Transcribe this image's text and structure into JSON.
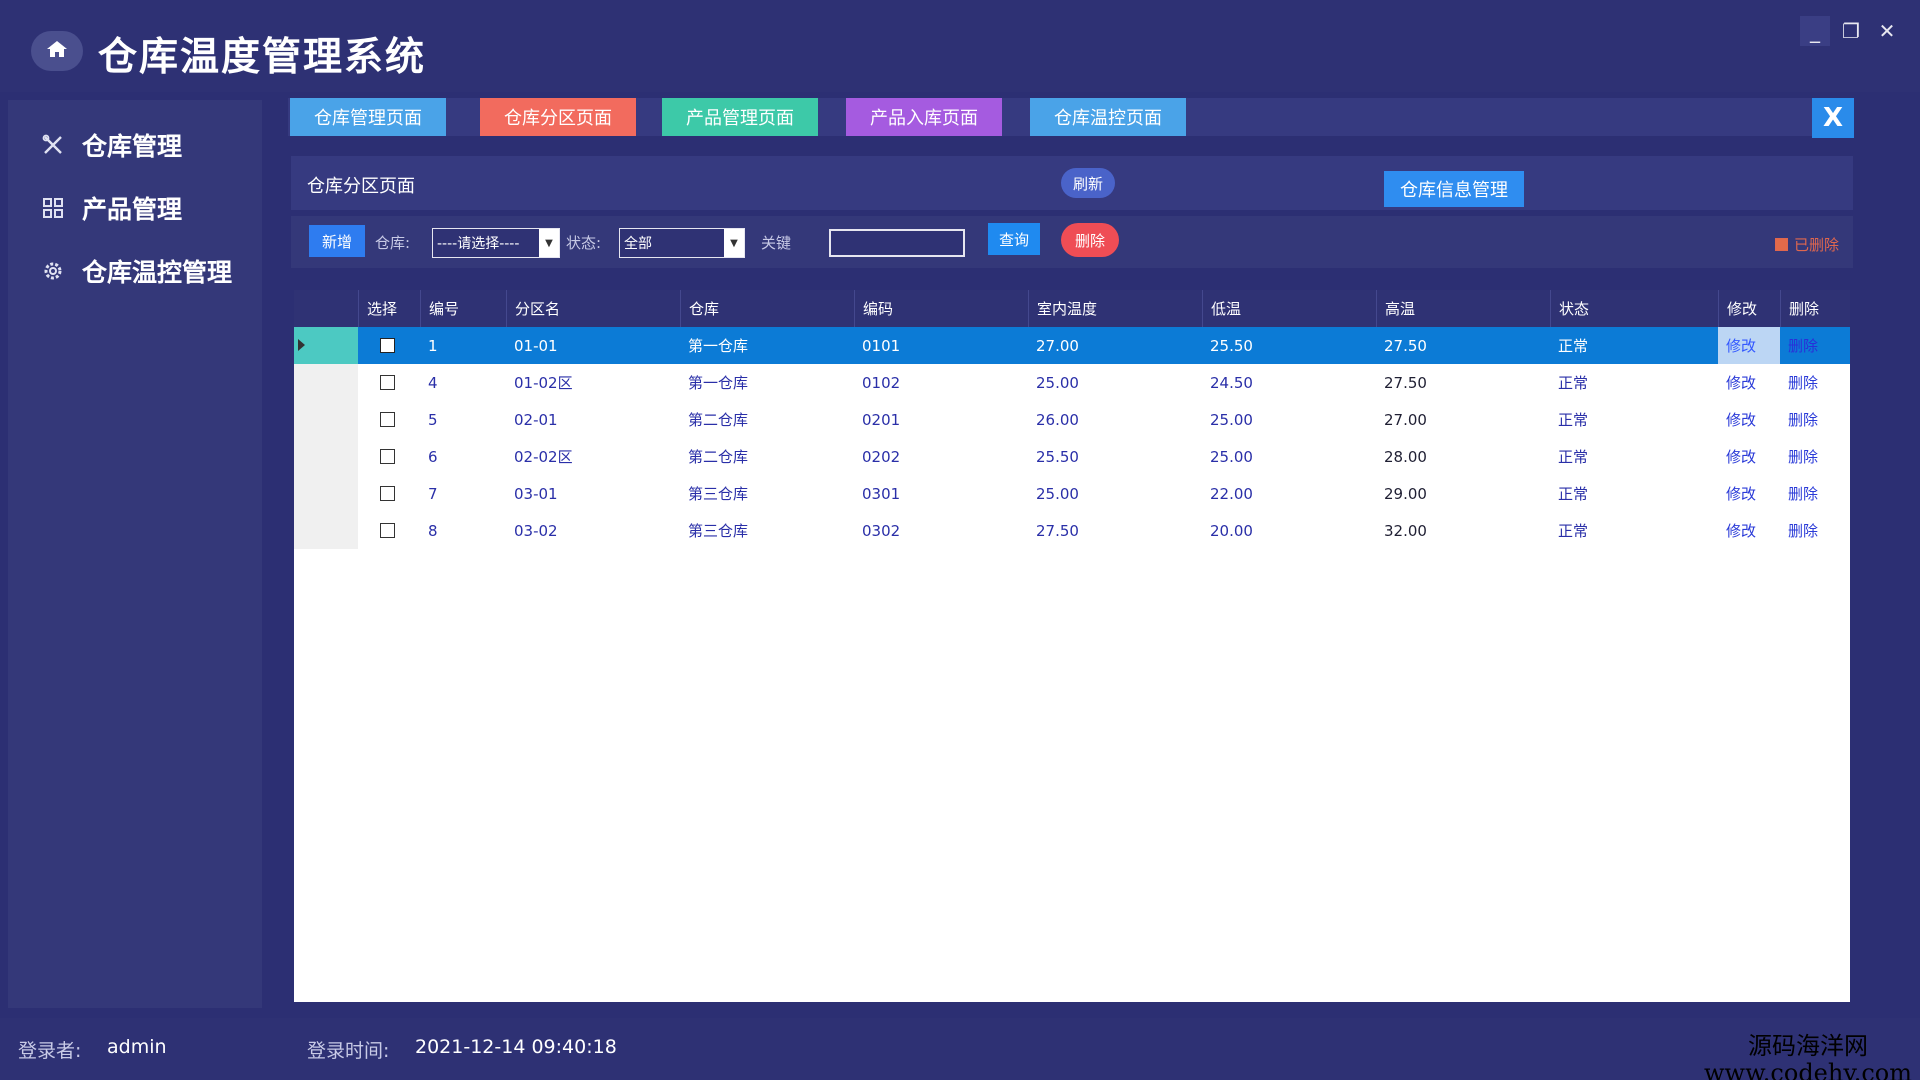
{
  "app": {
    "title": "仓库温度管理系统"
  },
  "window": {
    "minimize": "_",
    "restore": "❐",
    "close": "✕"
  },
  "sidebar": {
    "items": [
      {
        "label": "仓库管理",
        "icon": "tools-icon"
      },
      {
        "label": "产品管理",
        "icon": "grid-icon"
      },
      {
        "label": "仓库温控管理",
        "icon": "gear-icon"
      }
    ]
  },
  "tabs": [
    {
      "label": "仓库管理页面",
      "color": "#4aa3e8"
    },
    {
      "label": "仓库分区页面",
      "color": "#f26b5e"
    },
    {
      "label": "产品管理页面",
      "color": "#3dc9a8"
    },
    {
      "label": "产品入库页面",
      "color": "#a55be0"
    },
    {
      "label": "仓库温控页面",
      "color": "#4aa3e8"
    }
  ],
  "tab_close": "X",
  "page": {
    "title": "仓库分区页面",
    "refresh": "刷新",
    "info_button": "仓库信息管理"
  },
  "filters": {
    "add": "新增",
    "warehouse_label": "仓库:",
    "warehouse_value": "----请选择----",
    "status_label": "状态:",
    "status_value": "全部",
    "keyword_label": "关键",
    "keyword_value": "",
    "query": "查询",
    "delete": "删除",
    "deleted_label": "已删除"
  },
  "table": {
    "columns": [
      "选择",
      "编号",
      "分区名",
      "仓库",
      "编码",
      "室内温度",
      "低温",
      "高温",
      "状态",
      "修改",
      "删除"
    ],
    "rows": [
      {
        "id": "1",
        "zone": "01-01",
        "warehouse": "第一仓库",
        "code": "0101",
        "indoor": "27.00",
        "low": "25.50",
        "high": "27.50",
        "status": "正常",
        "edit": "修改",
        "del": "删除",
        "selected": true
      },
      {
        "id": "4",
        "zone": "01-02区",
        "warehouse": "第一仓库",
        "code": "0102",
        "indoor": "25.00",
        "low": "24.50",
        "high": "27.50",
        "status": "正常",
        "edit": "修改",
        "del": "删除"
      },
      {
        "id": "5",
        "zone": "02-01",
        "warehouse": "第二仓库",
        "code": "0201",
        "indoor": "26.00",
        "low": "25.00",
        "high": "27.00",
        "status": "正常",
        "edit": "修改",
        "del": "删除"
      },
      {
        "id": "6",
        "zone": "02-02区",
        "warehouse": "第二仓库",
        "code": "0202",
        "indoor": "25.50",
        "low": "25.00",
        "high": "28.00",
        "status": "正常",
        "edit": "修改",
        "del": "删除"
      },
      {
        "id": "7",
        "zone": "03-01",
        "warehouse": "第三仓库",
        "code": "0301",
        "indoor": "25.00",
        "low": "22.00",
        "high": "29.00",
        "status": "正常",
        "edit": "修改",
        "del": "删除"
      },
      {
        "id": "8",
        "zone": "03-02",
        "warehouse": "第三仓库",
        "code": "0302",
        "indoor": "27.50",
        "low": "20.00",
        "high": "32.00",
        "status": "正常",
        "edit": "修改",
        "del": "删除"
      }
    ]
  },
  "statusbar": {
    "user_label": "登录者:",
    "user": "admin",
    "time_label": "登录时间:",
    "time": "2021-12-14 09:40:18"
  },
  "watermark": {
    "line1": "源码海洋网",
    "line2": "www.codehy.com"
  }
}
